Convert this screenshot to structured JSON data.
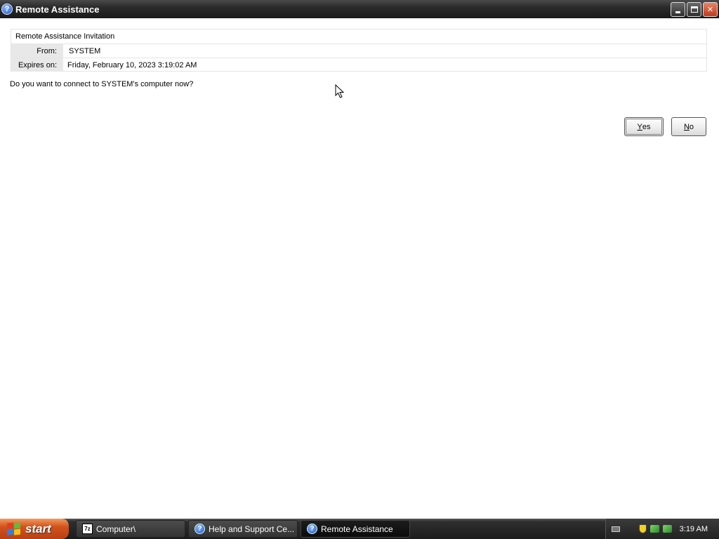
{
  "window": {
    "title": "Remote Assistance",
    "icon": "help-question-icon",
    "controls": [
      "minimize-icon",
      "restore-icon",
      "close-icon"
    ]
  },
  "invitation": {
    "heading": "Remote Assistance Invitation",
    "from_label": "From:",
    "from_value": "SYSTEM",
    "expires_label": "Expires on:",
    "expires_value": "Friday, February 10, 2023 3:19:02 AM"
  },
  "question": "Do you want to connect to SYSTEM's computer now?",
  "buttons": {
    "yes_accel": "Y",
    "yes_rest": "es",
    "no_accel": "N",
    "no_rest": "o"
  },
  "taskbar": {
    "start_label": "start",
    "tasks": [
      {
        "label": "Computer\\",
        "icon": "7zip-icon",
        "icon_text": "7z",
        "active": false
      },
      {
        "label": "Help and Support Ce...",
        "icon": "help-question-icon",
        "icon_text": "?",
        "active": false
      },
      {
        "label": "Remote Assistance",
        "icon": "help-question-icon",
        "icon_text": "?",
        "active": true
      }
    ],
    "tray_icons": [
      "keyboard-icon",
      "security-shield-icon",
      "network-icon",
      "network-icon"
    ],
    "clock": "3:19 AM"
  },
  "colors": {
    "start_button": "#d2521c",
    "taskbar": "#1c1c1c",
    "label_cell": "#e8e8e8"
  }
}
